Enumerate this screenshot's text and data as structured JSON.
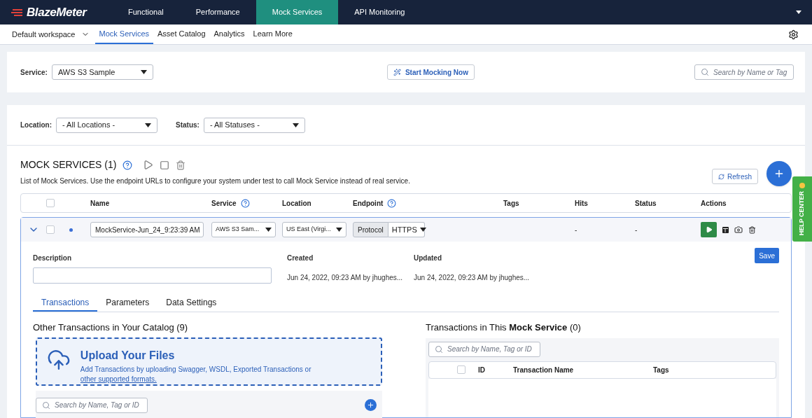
{
  "top_nav": {
    "logo": "BlazeMeter",
    "items": [
      {
        "label": "Functional",
        "selected": false
      },
      {
        "label": "Performance",
        "selected": false
      },
      {
        "label": "Mock Services",
        "selected": true
      },
      {
        "label": "API Monitoring",
        "selected": false
      }
    ]
  },
  "sub_nav": {
    "workspace": "Default workspace",
    "items": [
      {
        "label": "Mock Services",
        "selected": true
      },
      {
        "label": "Asset Catalog",
        "selected": false
      },
      {
        "label": "Analytics",
        "selected": false
      },
      {
        "label": "Learn More",
        "selected": false
      }
    ]
  },
  "service_bar": {
    "label": "Service:",
    "value": "AWS S3 Sample",
    "start_button": "Start Mocking Now",
    "search_placeholder": "Search by Name or Tag"
  },
  "filters": [
    {
      "label": "Location:",
      "value": "- All Locations -"
    },
    {
      "label": "Status:",
      "value": "- All Statuses -"
    }
  ],
  "mock_services": {
    "title": "MOCK SERVICES (1)",
    "all_checked": false,
    "description": "List of Mock Services. Use the endpoint URLs to configure your system under test to call Mock Service instead of real service.",
    "refresh": "Refresh",
    "columns": [
      {
        "label": "Name",
        "help": false
      },
      {
        "label": "Service",
        "help": true
      },
      {
        "label": "Location",
        "help": false
      },
      {
        "label": "Endpoint",
        "help": true
      },
      {
        "label": "Tags",
        "help": false
      },
      {
        "label": "Hits",
        "help": false
      },
      {
        "label": "Status",
        "help": false
      },
      {
        "label": "Actions",
        "help": false
      }
    ],
    "rows": [
      {
        "expanded": true,
        "checked": false,
        "name": "MockService-Jun_24_9:23:39 AM",
        "service": "AWS S3 Sam...",
        "location": "US East (Virgi...",
        "protocol_label": "Protocol",
        "protocol": "HTTPS",
        "hits": "-",
        "status": "-"
      }
    ]
  },
  "detail": {
    "description_label": "Description",
    "created_label": "Created",
    "created": "Jun 24, 2022, 09:23 AM by jhughes...",
    "updated_label": "Updated",
    "updated": "Jun 24, 2022, 09:23 AM by jhughes...",
    "save": "Save",
    "tabs": [
      {
        "label": "Transactions",
        "selected": true
      },
      {
        "label": "Parameters",
        "selected": false
      },
      {
        "label": "Data Settings",
        "selected": false
      }
    ]
  },
  "catalog": {
    "title": "Other Transactions in Your Catalog (9)",
    "upload_title": "Upload Your Files",
    "upload_text": "Add Transactions by uploading Swagger, WSDL, Exported Transactions or",
    "upload_link": "other supported formats.",
    "search_placeholder": "Search by Name, Tag or ID"
  },
  "service_transactions": {
    "all_checked": false,
    "title": "Transactions in This **Mock Service** (0)",
    "search_placeholder": "Search by Name, Tag or ID",
    "columns": [
      "ID",
      "Transaction Name",
      "Tags"
    ]
  },
  "help_center": "HELP CENTER"
}
